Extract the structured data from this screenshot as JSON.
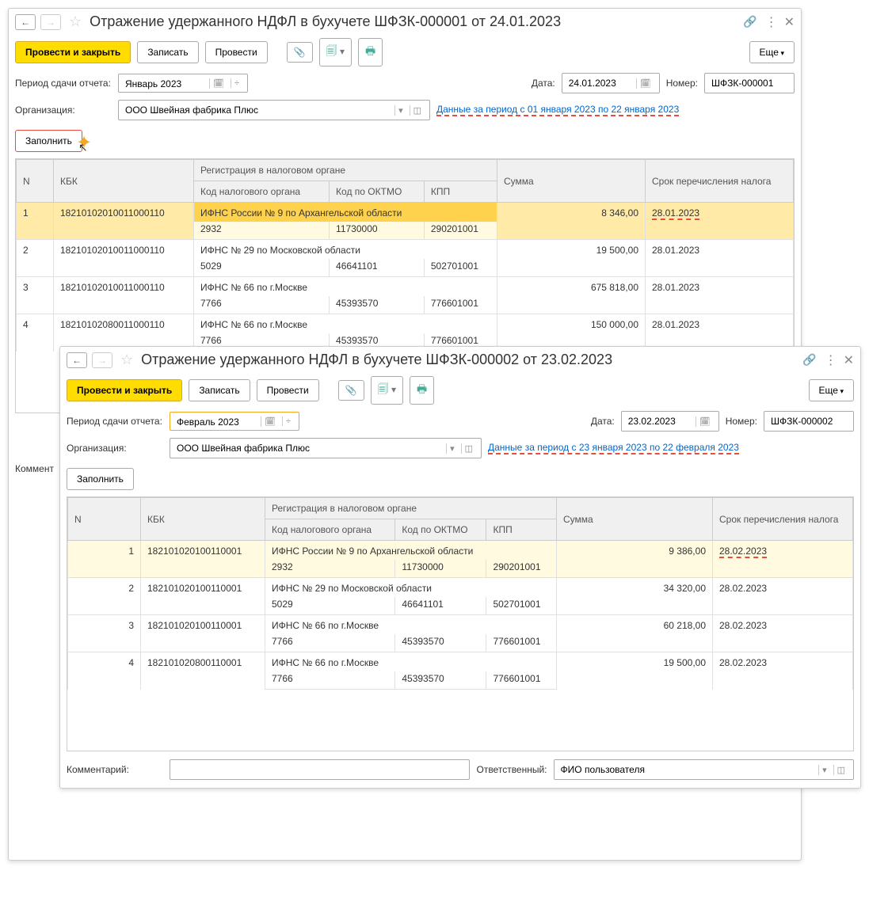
{
  "window1": {
    "title": "Отражение удержанного НДФЛ в бухучете ШФЗК-000001 от 24.01.2023",
    "toolbar": {
      "post_close": "Провести и закрыть",
      "save": "Записать",
      "post": "Провести",
      "more": "Еще"
    },
    "labels": {
      "period": "Период сдачи отчета:",
      "date": "Дата:",
      "number": "Номер:",
      "org": "Организация:",
      "fill": "Заполнить",
      "comment": "Коммент"
    },
    "values": {
      "period": "Январь 2023",
      "date": "24.01.2023",
      "number": "ШФЗК-000001",
      "org": "ООО Швейная фабрика Плюс",
      "period_link": "Данные за период с 01 января 2023 по 22 января 2023"
    },
    "table": {
      "headers": {
        "n": "N",
        "kbk": "КБК",
        "reg": "Регистрация в налоговом органе",
        "tax_code": "Код налогового органа",
        "oktmo": "Код по ОКТМО",
        "kpp": "КПП",
        "sum": "Сумма",
        "due": "Срок перечисления налога"
      },
      "rows": [
        {
          "n": "1",
          "kbk": "18210102010011000110",
          "reg": "ИФНС России № 9 по Архангельской области",
          "tax_code": "2932",
          "oktmo": "11730000",
          "kpp": "290201001",
          "sum": "8 346,00",
          "due": "28.01.2023"
        },
        {
          "n": "2",
          "kbk": "18210102010011000110",
          "reg": "ИФНС № 29 по Московской области",
          "tax_code": "5029",
          "oktmo": "46641101",
          "kpp": "502701001",
          "sum": "19 500,00",
          "due": "28.01.2023"
        },
        {
          "n": "3",
          "kbk": "18210102010011000110",
          "reg": "ИФНС № 66 по г.Москве",
          "tax_code": "7766",
          "oktmo": "45393570",
          "kpp": "776601001",
          "sum": "675 818,00",
          "due": "28.01.2023"
        },
        {
          "n": "4",
          "kbk": "18210102080011000110",
          "reg": "ИФНС № 66 по г.Москве",
          "tax_code": "7766",
          "oktmo": "45393570",
          "kpp": "776601001",
          "sum": "150 000,00",
          "due": "28.01.2023"
        }
      ]
    }
  },
  "window2": {
    "title": "Отражение удержанного НДФЛ в бухучете ШФЗК-000002 от 23.02.2023",
    "toolbar": {
      "post_close": "Провести и закрыть",
      "save": "Записать",
      "post": "Провести",
      "more": "Еще"
    },
    "labels": {
      "period": "Период сдачи отчета:",
      "date": "Дата:",
      "number": "Номер:",
      "org": "Организация:",
      "fill": "Заполнить",
      "comment": "Комментарий:",
      "responsible": "Ответственный:"
    },
    "values": {
      "period": "Февраль 2023",
      "date": "23.02.2023",
      "number": "ШФЗК-000002",
      "org": "ООО Швейная фабрика Плюс",
      "period_link": "Данные за период с 23 января 2023 по 22 февраля 2023",
      "responsible": "ФИО пользователя"
    },
    "table": {
      "headers": {
        "n": "N",
        "kbk": "КБК",
        "reg": "Регистрация в налоговом органе",
        "tax_code": "Код налогового органа",
        "oktmo": "Код по ОКТМО",
        "kpp": "КПП",
        "sum": "Сумма",
        "due": "Срок перечисления налога"
      },
      "rows": [
        {
          "n": "1",
          "kbk": "182101020100110001",
          "reg": "ИФНС России № 9 по Архангельской области",
          "tax_code": "2932",
          "oktmo": "11730000",
          "kpp": "290201001",
          "sum": "9 386,00",
          "due": "28.02.2023"
        },
        {
          "n": "2",
          "kbk": "182101020100110001",
          "reg": "ИФНС № 29 по Московской области",
          "tax_code": "5029",
          "oktmo": "46641101",
          "kpp": "502701001",
          "sum": "34 320,00",
          "due": "28.02.2023"
        },
        {
          "n": "3",
          "kbk": "182101020100110001",
          "reg": "ИФНС № 66 по г.Москве",
          "tax_code": "7766",
          "oktmo": "45393570",
          "kpp": "776601001",
          "sum": "60 218,00",
          "due": "28.02.2023"
        },
        {
          "n": "4",
          "kbk": "182101020800110001",
          "reg": "ИФНС № 66 по г.Москве",
          "tax_code": "7766",
          "oktmo": "45393570",
          "kpp": "776601001",
          "sum": "19 500,00",
          "due": "28.02.2023"
        }
      ]
    }
  }
}
